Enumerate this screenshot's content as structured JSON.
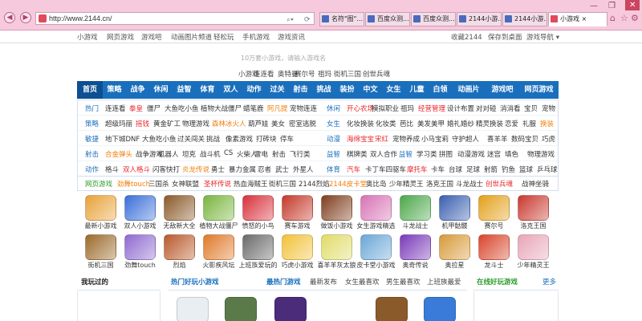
{
  "browser": {
    "url": "http://www.2144.cn/",
    "tabs": [
      "名符\"图\"...",
      "百度众测...",
      "百度众测...",
      "2144小游...",
      "2144小游...",
      "小游戏 ×"
    ]
  },
  "sitebar": {
    "left_links": [
      "小游戏",
      "网页游戏",
      "游戏吧",
      "动画图片频道",
      "轻松玩",
      "手机游戏",
      "游戏资讯"
    ],
    "right_links": [
      "收藏2144",
      "保存到桌面",
      "游戏导航 ▾"
    ]
  },
  "search": {
    "hint": "10万套小游戏，请输入游戏名",
    "hot_words": [
      "小游戏",
      "连连看",
      "奥特曼",
      "赛尔号",
      "祖玛",
      "街机三国",
      "创世兵魂"
    ]
  },
  "mainnav": [
    "首页",
    "策略",
    "战争",
    "休闲",
    "益智",
    "体育",
    "双人",
    "动作",
    "过关",
    "射击",
    "挑战",
    "装扮",
    "中文",
    "女生",
    "儿童",
    "白领",
    "动画片",
    "游戏吧",
    "网页游戏"
  ],
  "catrows": [
    {
      "head": "热门",
      "words": [
        "连连看",
        "拳皇",
        "僵尸",
        "大鱼吃小鱼",
        "植物大战僵尸",
        "蜡笔鹿",
        "阿凡提",
        "宠物连连",
        "休闲",
        "开心农场",
        "模拟职业",
        "祖玛",
        "经营管理",
        "设计布置",
        "对对碰",
        "消消看",
        "宝贝",
        "宠物"
      ]
    },
    {
      "head": "策略",
      "words": [
        "超级玛丽",
        "摇钱",
        "黄金矿工",
        "物理游戏",
        "森林冰火人",
        "葫芦娃",
        "美女",
        "密室逃脱",
        "女生",
        "化妆换装",
        "化妆类",
        "芭比",
        "美发美甲",
        "婚礼婚纱",
        "精灵换装",
        "恋爱",
        "礼服",
        "换装"
      ]
    },
    {
      "head": "敏捷",
      "words": [
        "地下城DNF",
        "大鱼吃小鱼",
        "过关闯关",
        "挑战",
        "像素游戏",
        "打砖块",
        "停车",
        "动漫",
        "海绵宝宝",
        "宋红",
        "宠物养成",
        "小马宝莉",
        "守护超人",
        "喜羊羊",
        "数码宝贝",
        "巧虎"
      ]
    },
    {
      "head": "射击",
      "words": [
        "合金弹头",
        "战争游戏",
        "机器人",
        "坦克",
        "战斗机",
        "CS",
        "火柴人",
        "雷电",
        "射击",
        "飞行类",
        "益智",
        "棋牌类",
        "双人合作",
        "益智",
        "学习类",
        "拼图",
        "动漫游戏",
        "迷宫",
        "填色",
        "物理游戏"
      ]
    },
    {
      "head": "动作",
      "words": [
        "格斗",
        "双人格斗",
        "闪客快打",
        "炎龙传说",
        "勇士",
        "暴力金属",
        "忍者",
        "武士",
        "外星人",
        "体育",
        "汽车",
        "卡丁车四驱车",
        "摩托车",
        "卡车",
        "台球",
        "足球",
        "射箭",
        "钓鱼",
        "篮球",
        "乒乓球"
      ]
    }
  ],
  "onlinerow": {
    "head": "网页游戏",
    "words": [
      "劲舞touch",
      "三国杀",
      "女神联盟",
      "圣杯传说",
      "热血海贼王",
      "街机三国",
      "2144烈焰",
      "2144皮卡堂",
      "奥比岛",
      "少年精灵王",
      "洛克王国",
      "斗龙战士",
      "创世兵魂",
      "战神坐骑"
    ]
  },
  "games": [
    {
      "label": "最新小游戏",
      "color": "#e8a23a"
    },
    {
      "label": "双人小游戏",
      "color": "#3b6fd8"
    },
    {
      "label": "无敌新大全",
      "color": "#8b5a2b"
    },
    {
      "label": "植物大战僵尸",
      "color": "#79b63f"
    },
    {
      "label": "愤怒的小鸟",
      "color": "#d8323c"
    },
    {
      "label": "赛车游戏",
      "color": "#c43a2a"
    },
    {
      "label": "做饭小游戏",
      "color": "#7f3f1f"
    },
    {
      "label": "女生游戏精选",
      "color": "#d873b5"
    },
    {
      "label": "斗龙战士",
      "color": "#4ca84a"
    },
    {
      "label": "机甲骷髅",
      "color": "#3a5fb0"
    },
    {
      "label": "赛尔号",
      "color": "#e3a11c"
    },
    {
      "label": "洛克王国",
      "color": "#c9392f"
    },
    {
      "label": "街机三国",
      "color": "#9b6a2b"
    },
    {
      "label": "劲舞touch",
      "color": "#8f6ad0"
    },
    {
      "label": "烈焰",
      "color": "#b85a2c"
    },
    {
      "label": "火影疾风坛",
      "color": "#e07a2a"
    },
    {
      "label": "上班族爱玩的",
      "color": "#6a6a6a"
    },
    {
      "label": "巧虎小游戏",
      "color": "#f2c23a"
    },
    {
      "label": "喜羊羊灰太狼",
      "color": "#e0dc68"
    },
    {
      "label": "皮卡堂小游戏",
      "color": "#6aa7d8"
    },
    {
      "label": "奥奇传说",
      "color": "#7a3ab8"
    },
    {
      "label": "奥拉星",
      "color": "#d89a3a"
    },
    {
      "label": "龙斗士",
      "color": "#d8462c"
    },
    {
      "label": "少年精灵王",
      "color": "#e8a6b8"
    }
  ],
  "sections": {
    "played": "我玩过的",
    "hot": "热门好玩小游戏",
    "tabs": [
      "最热门游戏",
      "最新发布",
      "女生最喜欢",
      "男生最喜欢",
      "上班族最爱"
    ],
    "online": "在线好玩游戏",
    "more": "更多"
  },
  "colors": {
    "brand_blue": "#1a6fbd",
    "chrome_pink": "#f7c9dc",
    "hot_red": "#e8262c"
  }
}
